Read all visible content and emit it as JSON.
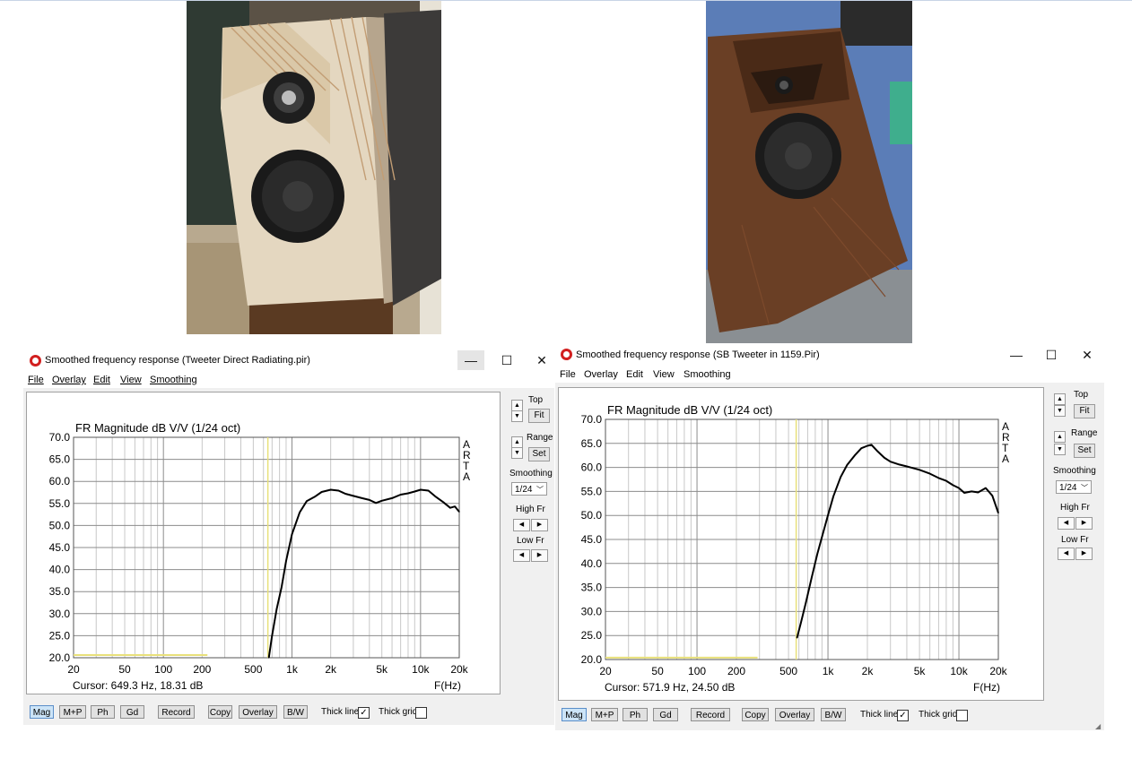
{
  "photos": [
    {
      "label": "Birch plywood bookshelf speaker with tweeter and woofer"
    },
    {
      "label": "Walnut speaker with waveguide tweeter and woofer"
    }
  ],
  "windows": [
    {
      "title": "Smoothed frequency response (Tweeter Direct Radiating.pir)",
      "win_buttons": {
        "minimize": "—",
        "maximize": "☐",
        "close": "✕"
      },
      "menu": {
        "file": "File",
        "overlay": "Overlay",
        "edit": "Edit",
        "view": "View",
        "smoothing": "Smoothing"
      },
      "chart_title": "FR Magnitude dB V/V (1/24 oct)",
      "arta": [
        "A",
        "R",
        "T",
        "A"
      ],
      "y_ticks": [
        "70.0",
        "65.0",
        "60.0",
        "55.0",
        "50.0",
        "45.0",
        "40.0",
        "35.0",
        "30.0",
        "25.0",
        "20.0"
      ],
      "x_ticks": [
        "20",
        "50",
        "100",
        "200",
        "500",
        "1k",
        "2k",
        "5k",
        "10k",
        "20k"
      ],
      "x_unit": "F(Hz)",
      "cursor": "Cursor: 649.3 Hz, 18.31 dB",
      "side": {
        "top": "Top",
        "fit": "Fit",
        "range": "Range",
        "set": "Set",
        "smoothing": "Smoothing",
        "smoothing_value": "1/24",
        "high_fr": "High Fr",
        "low_fr": "Low Fr"
      },
      "toolbar": {
        "mag": "Mag",
        "mp": "M+P",
        "ph": "Ph",
        "gd": "Gd",
        "record": "Record",
        "copy": "Copy",
        "overlay": "Overlay",
        "bw": "B/W",
        "thick_line": "Thick line",
        "thick_grid": "Thick grid"
      },
      "thick_line_checked": true,
      "thick_grid_checked": false,
      "colors": {
        "curve": "#000000",
        "cursor": "#e8e07a",
        "grid": "#c8c8c8",
        "major_grid": "#8c8c8c"
      },
      "chart_data": {
        "type": "line",
        "title": "FR Magnitude dB V/V (1/24 oct)",
        "xlabel": "F(Hz)",
        "x_scale": "log",
        "xlim": [
          20,
          20000
        ],
        "ylim": [
          20,
          70
        ],
        "cursor_hz": 649.3,
        "cursor_db": 18.31,
        "series": [
          {
            "x": [
              660,
              700,
              760,
              830,
              900,
              1000,
              1150,
              1300,
              1500,
              1700,
              2000,
              2300,
              2600,
              3000,
              3500,
              4000,
              4500,
              5000,
              6000,
              7000,
              8000,
              9000,
              10000,
              11500,
              13000,
              15000,
              17000,
              18500,
              20000
            ],
            "y": [
              20,
              25,
              31,
              36,
              42,
              48,
              53,
              55.5,
              56.5,
              57.6,
              58.1,
              57.9,
              57.2,
              56.7,
              56.2,
              55.8,
              55.1,
              55.6,
              56.2,
              57,
              57.3,
              57.7,
              58.1,
              57.9,
              56.6,
              55.3,
              54,
              54.3,
              53.1
            ]
          }
        ],
        "low_band": {
          "x": [
            20,
            220
          ],
          "y": [
            20.6,
            20.6
          ]
        }
      }
    },
    {
      "title": "Smoothed frequency response (SB Tweeter in 1159.Pir)",
      "win_buttons": {
        "minimize": "—",
        "maximize": "☐",
        "close": "✕"
      },
      "menu": {
        "file": "File",
        "overlay": "Overlay",
        "edit": "Edit",
        "view": "View",
        "smoothing": "Smoothing"
      },
      "chart_title": "FR Magnitude dB V/V (1/24 oct)",
      "arta": [
        "A",
        "R",
        "T",
        "A"
      ],
      "y_ticks": [
        "70.0",
        "65.0",
        "60.0",
        "55.0",
        "50.0",
        "45.0",
        "40.0",
        "35.0",
        "30.0",
        "25.0",
        "20.0"
      ],
      "x_ticks": [
        "20",
        "50",
        "100",
        "200",
        "500",
        "1k",
        "2k",
        "5k",
        "10k",
        "20k"
      ],
      "x_unit": "F(Hz)",
      "cursor": "Cursor: 571.9 Hz, 24.50 dB",
      "side": {
        "top": "Top",
        "fit": "Fit",
        "range": "Range",
        "set": "Set",
        "smoothing": "Smoothing",
        "smoothing_value": "1/24",
        "high_fr": "High Fr",
        "low_fr": "Low Fr"
      },
      "toolbar": {
        "mag": "Mag",
        "mp": "M+P",
        "ph": "Ph",
        "gd": "Gd",
        "record": "Record",
        "copy": "Copy",
        "overlay": "Overlay",
        "bw": "B/W",
        "thick_line": "Thick line",
        "thick_grid": "Thick grid"
      },
      "thick_line_checked": true,
      "thick_grid_checked": false,
      "colors": {
        "curve": "#000000",
        "cursor": "#e8e07a",
        "grid": "#c8c8c8",
        "major_grid": "#8c8c8c"
      },
      "chart_data": {
        "type": "line",
        "title": "FR Magnitude dB V/V (1/24 oct)",
        "xlabel": "F(Hz)",
        "x_scale": "log",
        "xlim": [
          20,
          20000
        ],
        "ylim": [
          20,
          70
        ],
        "cursor_hz": 571.9,
        "cursor_db": 24.5,
        "series": [
          {
            "x": [
              580,
              620,
              680,
              750,
              830,
              920,
              1000,
              1100,
              1250,
              1400,
              1600,
              1800,
              2000,
              2150,
              2400,
              2700,
              3000,
              3500,
              4000,
              5000,
              6000,
              7000,
              8000,
              9000,
              10000,
              11000,
              12500,
              14000,
              16000,
              18000,
              20000
            ],
            "y": [
              24.5,
              27.5,
              32,
              37,
              42,
              46.5,
              50,
              54,
              58,
              60.5,
              62.5,
              64,
              64.5,
              64.7,
              63.3,
              62,
              61.2,
              60.6,
              60.2,
              59.5,
              58.7,
              57.8,
              57.2,
              56.3,
              55.7,
              54.7,
              55,
              54.8,
              55.7,
              54.1,
              50.5
            ]
          }
        ],
        "low_band": {
          "x": [
            20,
            290
          ],
          "y": [
            20.4,
            20.4
          ]
        }
      }
    }
  ]
}
